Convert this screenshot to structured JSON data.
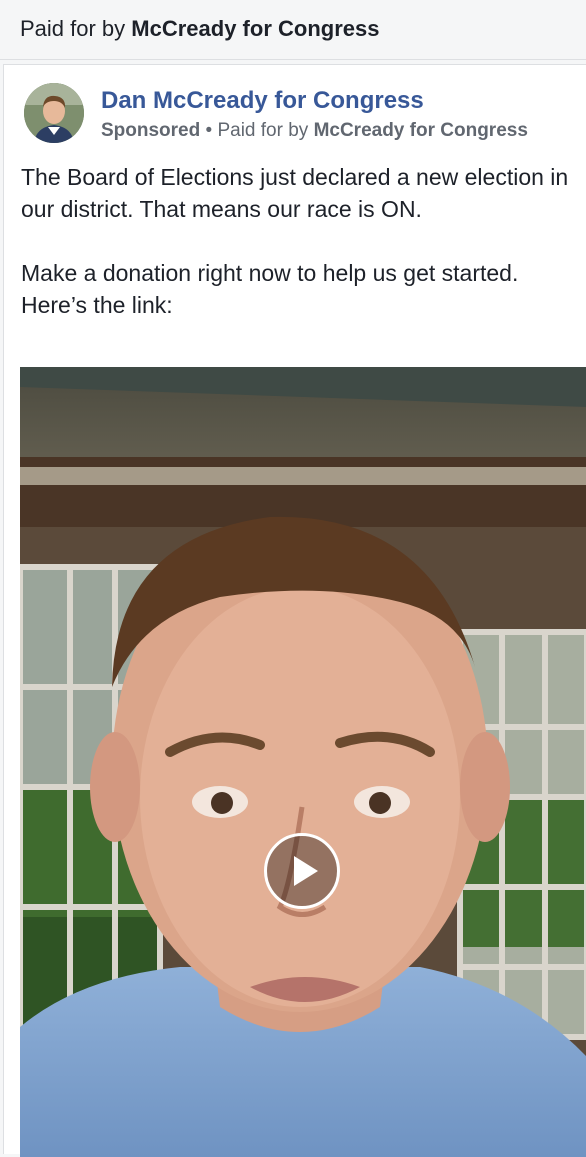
{
  "disclaimer": {
    "prefix": "Paid for by ",
    "payer": "McCready for Congress"
  },
  "post": {
    "page_name": "Dan McCready for Congress",
    "sponsored_label": "Sponsored",
    "separator": " • ",
    "paid_prefix": "Paid for by ",
    "paid_payer": "McCready for Congress",
    "paragraphs": [
      "The Board of Elections just declared a new election in our district. That means our race is ON.",
      "Make a donation right now to help us get started. Here’s the link:"
    ]
  },
  "video": {
    "play_icon": "play-icon"
  },
  "colors": {
    "link_blue": "#385898",
    "text": "#1d2129",
    "meta": "#616770"
  }
}
